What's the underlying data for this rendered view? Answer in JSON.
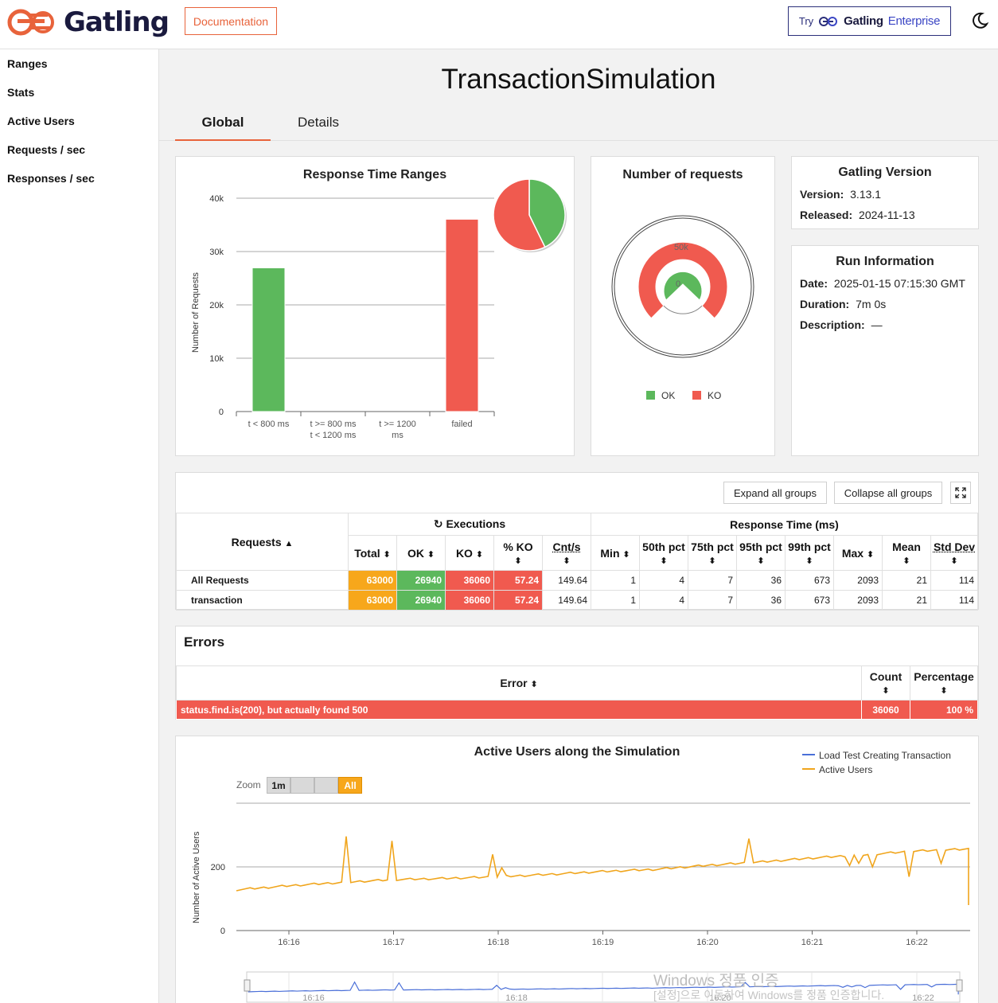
{
  "header": {
    "logo_text": "Gatling",
    "documentation_label": "Documentation",
    "enterprise_try": "Try",
    "enterprise_name": "Gatling",
    "enterprise_suffix": "Enterprise",
    "theme_icon": "moon-icon"
  },
  "sidebar": {
    "items": [
      {
        "label": "Ranges"
      },
      {
        "label": "Stats"
      },
      {
        "label": "Active Users"
      },
      {
        "label": "Requests / sec"
      },
      {
        "label": "Responses / sec"
      }
    ]
  },
  "main": {
    "title": "TransactionSimulation",
    "tabs": [
      {
        "label": "Global"
      },
      {
        "label": "Details"
      }
    ]
  },
  "colors": {
    "ok": "#5cb85c",
    "ko": "#f05a4f",
    "total": "#f7a71b",
    "accent": "#e8633b",
    "users_line": "#f0a51c",
    "nav_line": "#4a6fd8"
  },
  "ranges_chart": {
    "title": "Response Time Ranges",
    "ylabel": "Number of Requests",
    "ticks": [
      "0",
      "10k",
      "20k",
      "30k",
      "40k"
    ]
  },
  "requests_chart": {
    "title": "Number of requests",
    "gauge_labels": [
      "50k",
      "0"
    ],
    "legend": [
      "OK",
      "KO"
    ]
  },
  "version_info": {
    "title": "Gatling Version",
    "version_label": "Version:",
    "version": "3.13.1",
    "released_label": "Released:",
    "released": "2024-11-13"
  },
  "run_info": {
    "title": "Run Information",
    "date_label": "Date:",
    "date": "2025-01-15 07:15:30 GMT",
    "duration_label": "Duration:",
    "duration": "7m 0s",
    "description_label": "Description:",
    "description": "—"
  },
  "stats": {
    "expand_label": "Expand all groups",
    "collapse_label": "Collapse all groups",
    "requests_header": "Requests",
    "executions_header": "Executions",
    "response_time_header": "Response Time (ms)",
    "columns": [
      "Total",
      "OK",
      "KO",
      "% KO",
      "Cnt/s",
      "Min",
      "50th pct",
      "75th pct",
      "95th pct",
      "99th pct",
      "Max",
      "Mean",
      "Std Dev"
    ],
    "rows": [
      {
        "name": "All Requests",
        "total": "63000",
        "ok": "26940",
        "ko": "36060",
        "pko": "57.24",
        "cnts": "149.64",
        "min": "1",
        "p50": "4",
        "p75": "7",
        "p95": "36",
        "p99": "673",
        "max": "2093",
        "mean": "21",
        "std": "114"
      },
      {
        "name": "transaction",
        "total": "63000",
        "ok": "26940",
        "ko": "36060",
        "pko": "57.24",
        "cnts": "149.64",
        "min": "1",
        "p50": "4",
        "p75": "7",
        "p95": "36",
        "p99": "673",
        "max": "2093",
        "mean": "21",
        "std": "114"
      }
    ]
  },
  "errors": {
    "title": "Errors",
    "col_error": "Error",
    "col_count": "Count",
    "col_percentage": "Percentage",
    "rows": [
      {
        "message": "status.find.is(200), but actually found 500",
        "count": "36060",
        "percentage": "100 %"
      }
    ]
  },
  "active_users": {
    "title": "Active Users along the Simulation",
    "legend": [
      "Load Test Creating Transaction",
      "Active Users"
    ],
    "zoom_label": "Zoom",
    "zoom_buttons": [
      "1m",
      "",
      "",
      "All"
    ],
    "ylabel": "Number of Active Users",
    "yticks": [
      "0",
      "200"
    ],
    "xticks": [
      "16:16",
      "16:17",
      "16:18",
      "16:19",
      "16:20",
      "16:21",
      "16:22"
    ]
  },
  "watermark": {
    "line1": "Windows 정품 인증",
    "line2": "[설정]으로 이동하여 Windows를 정품 인증합니다."
  },
  "chart_data": [
    {
      "type": "bar",
      "title": "Response Time Ranges",
      "categories": [
        "t < 800 ms",
        "t >= 800 ms t < 1200 ms",
        "t >= 1200 ms",
        "failed"
      ],
      "values": [
        26940,
        0,
        0,
        36060
      ],
      "colors": [
        "#5cb85c",
        "#f7a71b",
        "#f05a4f",
        "#f05a4f"
      ],
      "ylabel": "Number of Requests",
      "ylim": [
        0,
        40000
      ]
    },
    {
      "type": "pie",
      "title": "Response Time Ranges",
      "labels": [
        "t < 800 ms",
        "failed"
      ],
      "values": [
        26940,
        36060
      ]
    },
    {
      "type": "line",
      "title": "Active Users along the Simulation",
      "ylabel": "Number of Active Users",
      "ylim": [
        0,
        250
      ],
      "series": [
        {
          "name": "Active Users",
          "x": [
            "16:15:30",
            "16:16",
            "16:16:30",
            "16:17",
            "16:17:30",
            "16:18",
            "16:18:30",
            "16:19",
            "16:19:30",
            "16:20",
            "16:20:30",
            "16:21",
            "16:21:30",
            "16:22",
            "16:22:30"
          ],
          "values": [
            100,
            110,
            118,
            125,
            128,
            132,
            138,
            145,
            150,
            160,
            168,
            178,
            186,
            195,
            200
          ]
        }
      ]
    }
  ]
}
